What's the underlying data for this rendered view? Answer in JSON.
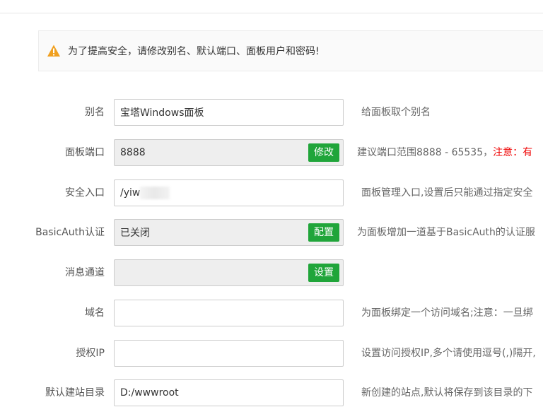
{
  "alert": {
    "icon": "warning-triangle-icon",
    "color": "#f0a020",
    "text": "为了提高安全，请修改别名、默认端口、面板用户和密码!"
  },
  "settings": {
    "alias": {
      "label": "别名",
      "value": "宝塔Windows面板",
      "hint": "给面板取个别名"
    },
    "port": {
      "label": "面板端口",
      "value": "8888",
      "button": "修改",
      "hint": "建议端口范围8888 - 65535，",
      "hint_warn": "注意：有"
    },
    "entrance": {
      "label": "安全入口",
      "value": "/yiw",
      "hint": "面板管理入口,设置后只能通过指定安全"
    },
    "basicauth": {
      "label": "BasicAuth认证",
      "value": "已关闭",
      "button": "配置",
      "hint": "为面板增加一道基于BasicAuth的认证服"
    },
    "message": {
      "label": "消息通道",
      "value": "",
      "button": "设置"
    },
    "domain": {
      "label": "域名",
      "value": "",
      "hint": "为面板绑定一个访问域名;注意：一旦绑"
    },
    "auth_ip": {
      "label": "授权IP",
      "value": "",
      "hint": "设置访问授权IP,多个请使用逗号(,)隔开,"
    },
    "site_dir": {
      "label": "默认建站目录",
      "value": "D:/wwwroot",
      "hint": "新创建的站点,默认将保存到该目录的下"
    }
  },
  "colors": {
    "accent_green": "#20a53a",
    "warn_red": "#ef0808",
    "readonly_bg": "#eeeeee"
  }
}
